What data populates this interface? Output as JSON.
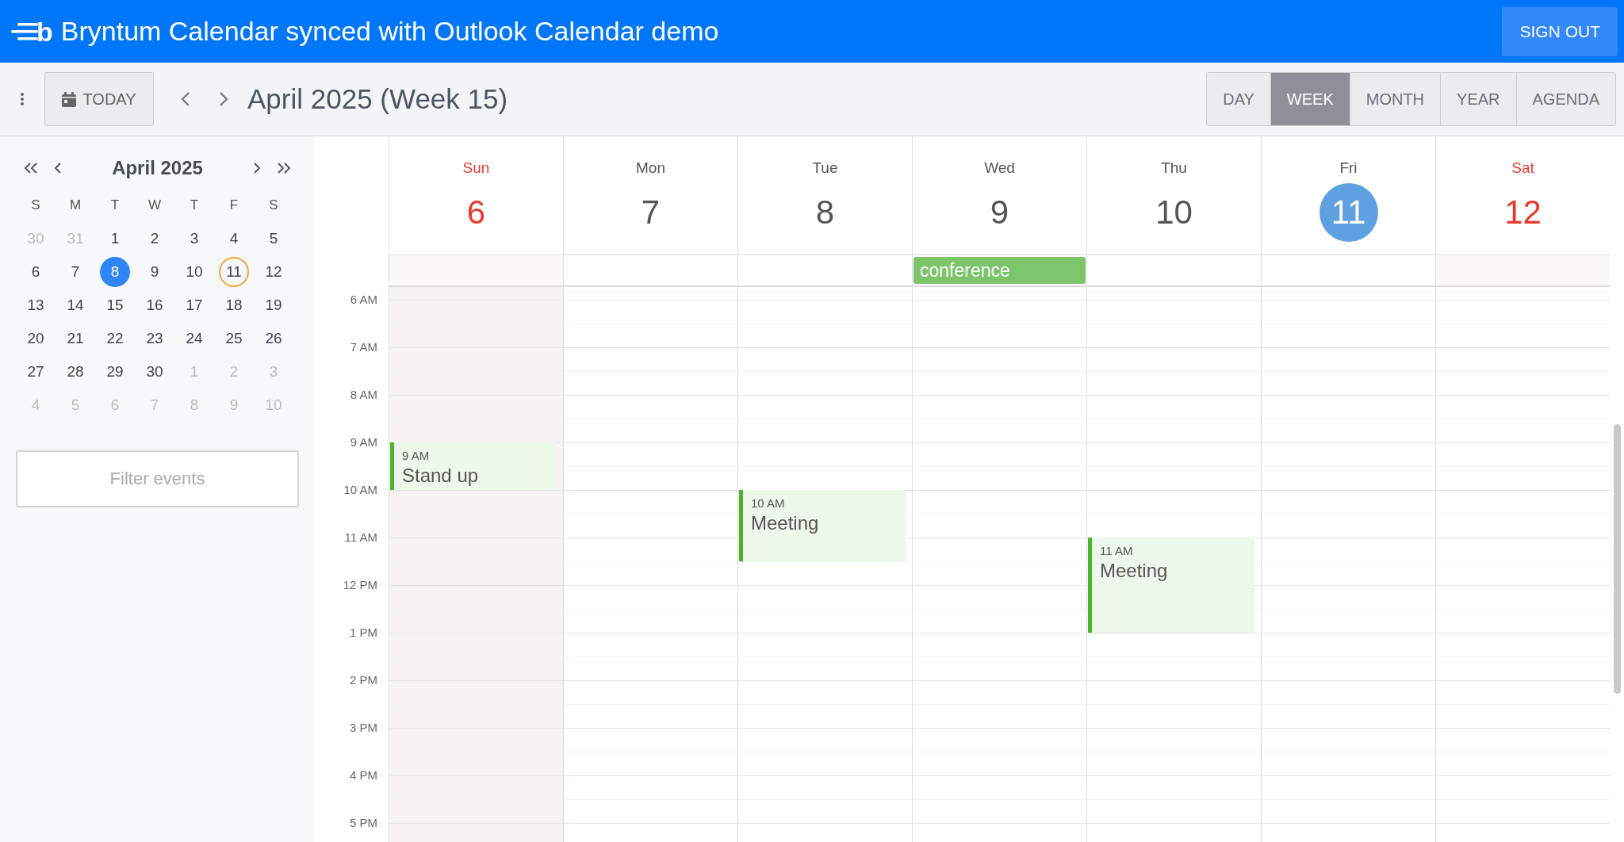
{
  "app": {
    "logo": "b",
    "title": "Bryntum Calendar synced with Outlook Calendar demo",
    "sign_out": "SIGN OUT"
  },
  "toolbar": {
    "today": "TODAY",
    "title": "April 2025 (Week 15)",
    "views": [
      {
        "label": "DAY",
        "selected": false
      },
      {
        "label": "WEEK",
        "selected": true
      },
      {
        "label": "MONTH",
        "selected": false
      },
      {
        "label": "YEAR",
        "selected": false
      },
      {
        "label": "AGENDA",
        "selected": false
      }
    ]
  },
  "mini_calendar": {
    "title": "April 2025",
    "weekdays": [
      "S",
      "M",
      "T",
      "W",
      "T",
      "F",
      "S"
    ],
    "weeks": [
      [
        {
          "text": "30",
          "other_month": true,
          "selected": false,
          "today": false
        },
        {
          "text": "31",
          "other_month": true,
          "selected": false,
          "today": false
        },
        {
          "text": "1",
          "other_month": false,
          "selected": false,
          "today": false
        },
        {
          "text": "2",
          "other_month": false,
          "selected": false,
          "today": false
        },
        {
          "text": "3",
          "other_month": false,
          "selected": false,
          "today": false
        },
        {
          "text": "4",
          "other_month": false,
          "selected": false,
          "today": false
        },
        {
          "text": "5",
          "other_month": false,
          "selected": false,
          "today": false
        }
      ],
      [
        {
          "text": "6",
          "other_month": false,
          "selected": false,
          "today": false
        },
        {
          "text": "7",
          "other_month": false,
          "selected": false,
          "today": false
        },
        {
          "text": "8",
          "other_month": false,
          "selected": true,
          "today": false
        },
        {
          "text": "9",
          "other_month": false,
          "selected": false,
          "today": false
        },
        {
          "text": "10",
          "other_month": false,
          "selected": false,
          "today": false
        },
        {
          "text": "11",
          "other_month": false,
          "selected": false,
          "today": true
        },
        {
          "text": "12",
          "other_month": false,
          "selected": false,
          "today": false
        }
      ],
      [
        {
          "text": "13",
          "other_month": false,
          "selected": false,
          "today": false
        },
        {
          "text": "14",
          "other_month": false,
          "selected": false,
          "today": false
        },
        {
          "text": "15",
          "other_month": false,
          "selected": false,
          "today": false
        },
        {
          "text": "16",
          "other_month": false,
          "selected": false,
          "today": false
        },
        {
          "text": "17",
          "other_month": false,
          "selected": false,
          "today": false
        },
        {
          "text": "18",
          "other_month": false,
          "selected": false,
          "today": false
        },
        {
          "text": "19",
          "other_month": false,
          "selected": false,
          "today": false
        }
      ],
      [
        {
          "text": "20",
          "other_month": false,
          "selected": false,
          "today": false
        },
        {
          "text": "21",
          "other_month": false,
          "selected": false,
          "today": false
        },
        {
          "text": "22",
          "other_month": false,
          "selected": false,
          "today": false
        },
        {
          "text": "23",
          "other_month": false,
          "selected": false,
          "today": false
        },
        {
          "text": "24",
          "other_month": false,
          "selected": false,
          "today": false
        },
        {
          "text": "25",
          "other_month": false,
          "selected": false,
          "today": false
        },
        {
          "text": "26",
          "other_month": false,
          "selected": false,
          "today": false
        }
      ],
      [
        {
          "text": "27",
          "other_month": false,
          "selected": false,
          "today": false
        },
        {
          "text": "28",
          "other_month": false,
          "selected": false,
          "today": false
        },
        {
          "text": "29",
          "other_month": false,
          "selected": false,
          "today": false
        },
        {
          "text": "30",
          "other_month": false,
          "selected": false,
          "today": false
        },
        {
          "text": "1",
          "other_month": true,
          "selected": false,
          "today": false
        },
        {
          "text": "2",
          "other_month": true,
          "selected": false,
          "today": false
        },
        {
          "text": "3",
          "other_month": true,
          "selected": false,
          "today": false
        }
      ],
      [
        {
          "text": "4",
          "other_month": true,
          "selected": false,
          "today": false
        },
        {
          "text": "5",
          "other_month": true,
          "selected": false,
          "today": false
        },
        {
          "text": "6",
          "other_month": true,
          "selected": false,
          "today": false
        },
        {
          "text": "7",
          "other_month": true,
          "selected": false,
          "today": false
        },
        {
          "text": "8",
          "other_month": true,
          "selected": false,
          "today": false
        },
        {
          "text": "9",
          "other_month": true,
          "selected": false,
          "today": false
        },
        {
          "text": "10",
          "other_month": true,
          "selected": false,
          "today": false
        }
      ]
    ]
  },
  "filter": {
    "placeholder": "Filter events"
  },
  "week": {
    "hours": [
      "6 AM",
      "7 AM",
      "8 AM",
      "9 AM",
      "10 AM",
      "11 AM",
      "12 PM",
      "1 PM",
      "2 PM",
      "3 PM",
      "4 PM",
      "5 PM"
    ],
    "days": [
      {
        "name": "Sun",
        "date": "6",
        "weekend": true,
        "today": false,
        "shaded": true,
        "events": [
          {
            "time": "9 AM",
            "kind": "hour",
            "title": "Stand up"
          }
        ]
      },
      {
        "name": "Mon",
        "date": "7",
        "weekend": false,
        "today": false,
        "shaded": false
      },
      {
        "name": "Tue",
        "date": "8",
        "weekend": false,
        "today": false,
        "shaded": false,
        "events": [
          {
            "time": "10 AM",
            "kind": "ninety-minutes",
            "title": "Meeting"
          }
        ]
      },
      {
        "name": "Wed",
        "date": "9",
        "weekend": false,
        "today": false,
        "shaded": false,
        "all_day": [
          {
            "title": "conference"
          }
        ]
      },
      {
        "name": "Thu",
        "date": "10",
        "weekend": false,
        "today": false,
        "shaded": false,
        "events": [
          {
            "time": "11 AM",
            "kind": "two-hours",
            "title": "Meeting"
          }
        ]
      },
      {
        "name": "Fri",
        "date": "11",
        "weekend": false,
        "today": true,
        "shaded": false
      },
      {
        "name": "Sat",
        "date": "12",
        "weekend": true,
        "today": false,
        "shaded": false
      }
    ]
  }
}
